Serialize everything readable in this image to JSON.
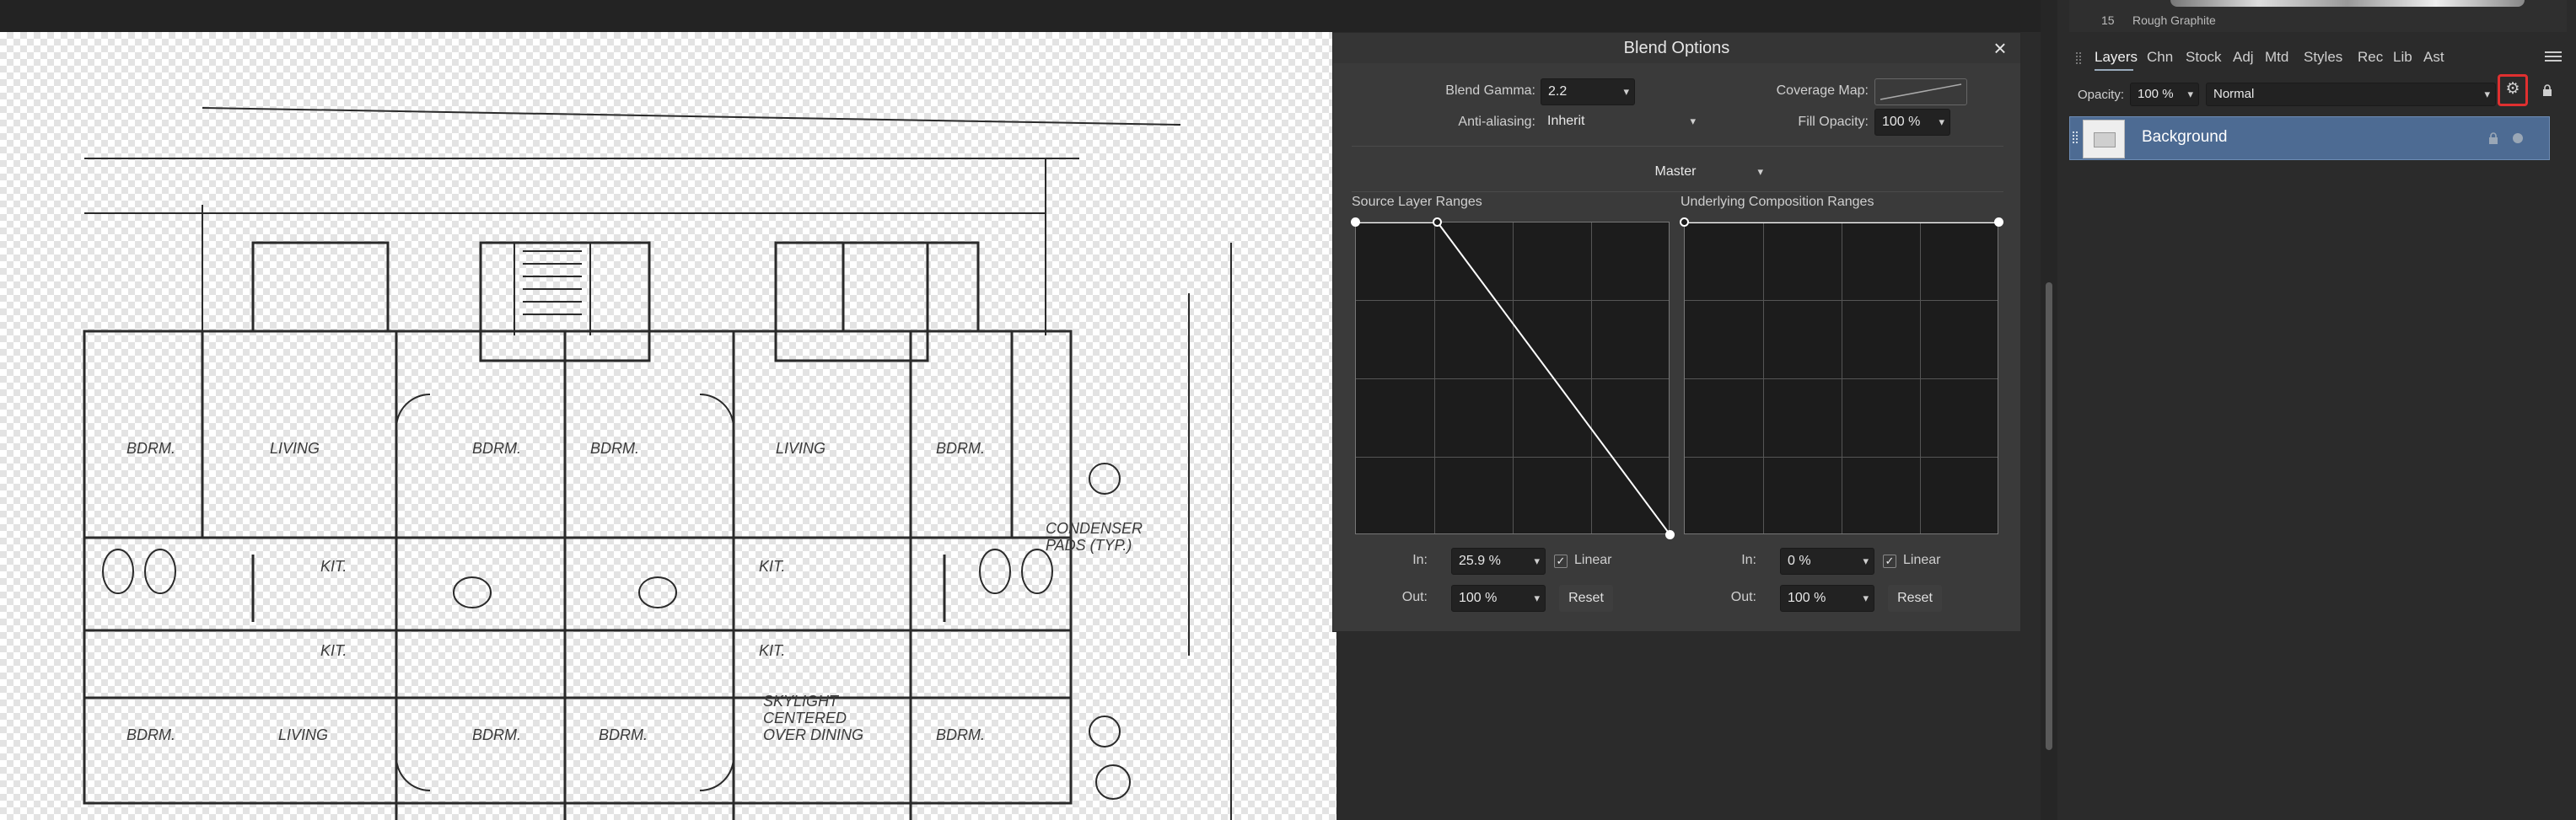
{
  "dialog": {
    "title": "Blend Options",
    "blend_gamma_label": "Blend Gamma:",
    "blend_gamma_value": "2.2",
    "coverage_map_label": "Coverage Map:",
    "anti_aliasing_label": "Anti-aliasing:",
    "anti_aliasing_value": "Inherit",
    "fill_opacity_label": "Fill Opacity:",
    "fill_opacity_value": "100 %",
    "channel_value": "Master",
    "source": {
      "title": "Source Layer Ranges",
      "in_label": "In:",
      "in_value": "25.9 %",
      "out_label": "Out:",
      "out_value": "100 %",
      "linear_label": "Linear",
      "linear_checked": true,
      "reset_label": "Reset"
    },
    "underlying": {
      "title": "Underlying Composition Ranges",
      "in_label": "In:",
      "in_value": "0 %",
      "out_label": "Out:",
      "out_value": "100 %",
      "linear_label": "Linear",
      "linear_checked": true,
      "reset_label": "Reset"
    }
  },
  "brush": {
    "number": "15",
    "name": "Rough Graphite"
  },
  "panel": {
    "tabs": [
      "Layers",
      "Chn",
      "Stock",
      "Adj",
      "Mtd",
      "Styles",
      "Rec",
      "Lib",
      "Ast"
    ],
    "active_tab": "Layers",
    "opacity_label": "Opacity:",
    "opacity_value": "100 %",
    "blend_mode_value": "Normal"
  },
  "layers": [
    {
      "name": "Background",
      "selected": true
    }
  ],
  "icons": {
    "close": "close-icon",
    "gear": "gear-icon",
    "lock": "lock-icon",
    "menu": "hamburger-menu-icon"
  },
  "colors": {
    "highlight": "#e03030",
    "selected_layer": "#4d6b93"
  }
}
